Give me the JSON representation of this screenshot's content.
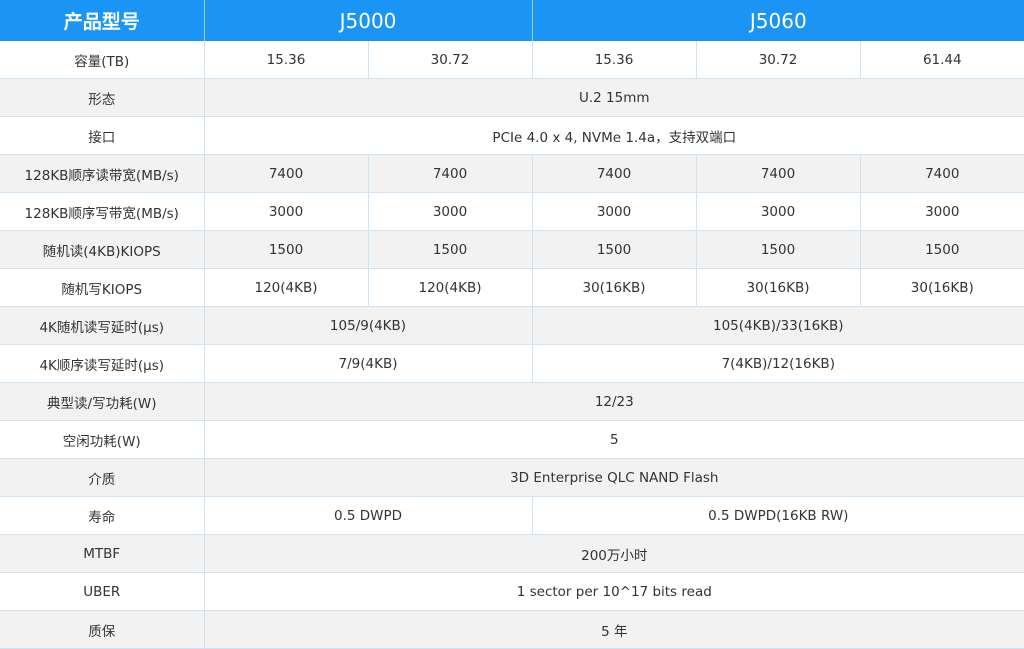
{
  "header": {
    "label": "产品型号",
    "models": [
      "J5000",
      "J5060"
    ]
  },
  "rows": [
    {
      "label": "容量(TB)",
      "cells": [
        "15.36",
        "30.72",
        "15.36",
        "30.72",
        "61.44"
      ]
    },
    {
      "label": "形态",
      "cells": [
        "U.2 15mm"
      ]
    },
    {
      "label": "接口",
      "cells": [
        "PCIe 4.0 x 4, NVMe 1.4a，支持双端口"
      ]
    },
    {
      "label": "128KB顺序读带宽(MB/s)",
      "cells": [
        "7400",
        "7400",
        "7400",
        "7400",
        "7400"
      ]
    },
    {
      "label": "128KB顺序写带宽(MB/s)",
      "cells": [
        "3000",
        "3000",
        "3000",
        "3000",
        "3000"
      ]
    },
    {
      "label": "随机读(4KB)KIOPS",
      "cells": [
        "1500",
        "1500",
        "1500",
        "1500",
        "1500"
      ]
    },
    {
      "label": "随机写KIOPS",
      "cells": [
        "120(4KB)",
        "120(4KB)",
        "30(16KB)",
        "30(16KB)",
        "30(16KB)"
      ]
    },
    {
      "label": "4K随机读写延时(μs)",
      "cells": [
        "105/9(4KB)",
        "105(4KB)/33(16KB)"
      ]
    },
    {
      "label": "4K顺序读写延时(μs)",
      "cells": [
        "7/9(4KB)",
        "7(4KB)/12(16KB)"
      ]
    },
    {
      "label": "典型读/写功耗(W)",
      "cells": [
        "12/23"
      ]
    },
    {
      "label": "空闲功耗(W)",
      "cells": [
        "5"
      ]
    },
    {
      "label": "介质",
      "cells": [
        "3D Enterprise QLC NAND Flash"
      ]
    },
    {
      "label": "寿命",
      "cells": [
        "0.5 DWPD",
        "0.5 DWPD(16KB RW)"
      ]
    },
    {
      "label": "MTBF",
      "cells": [
        "200万小时"
      ]
    },
    {
      "label": "UBER",
      "cells": [
        "1 sector per 10^17 bits read"
      ]
    },
    {
      "label": "质保",
      "cells": [
        "5 年"
      ]
    }
  ]
}
